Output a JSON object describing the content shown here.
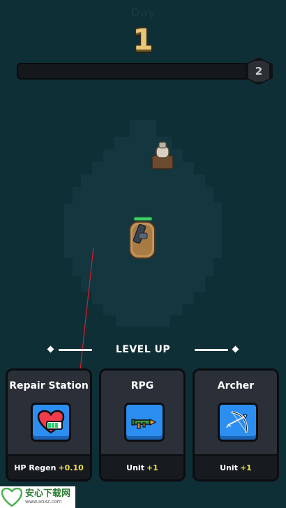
{
  "hud": {
    "day_label": "Day",
    "day_number": "1",
    "level_badge": "2"
  },
  "level_up": {
    "title": "LEVEL UP",
    "cards": [
      {
        "title": "Repair Station",
        "icon": "heart-repair-icon",
        "stat_label": "HP Regen",
        "stat_value": "+0.10"
      },
      {
        "title": "RPG",
        "icon": "rocket-launcher-icon",
        "stat_label": "Unit",
        "stat_value": "+1"
      },
      {
        "title": "Archer",
        "icon": "bow-arrow-icon",
        "stat_label": "Unit",
        "stat_value": "+1"
      }
    ]
  },
  "watermark": {
    "main": "安心下载网",
    "sub": "www.anxz.com"
  },
  "colors": {
    "background": "#0f2f37",
    "card": "#2b2f37",
    "icon_button": "#2c8ef0",
    "stat_highlight": "#f2e04a",
    "day_number": "#e8c77a"
  }
}
